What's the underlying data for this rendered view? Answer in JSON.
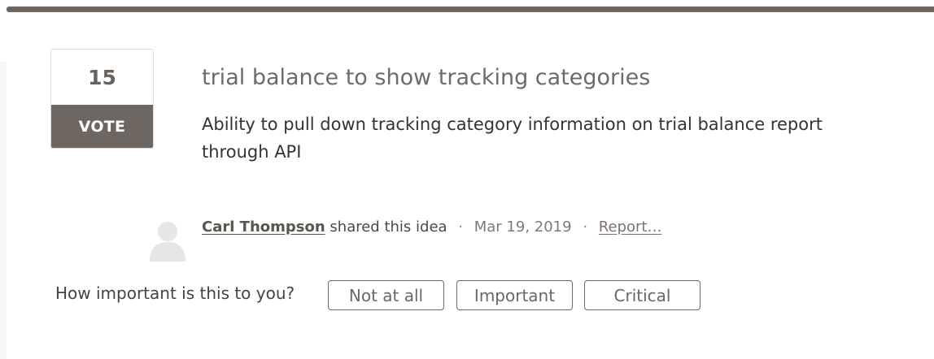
{
  "idea": {
    "vote_count": "15",
    "vote_label": "VOTE",
    "title": "trial balance to show tracking categories",
    "description": "Ability to pull down tracking category information on trial balance report through API"
  },
  "meta": {
    "author": "Carl Thompson",
    "shared_text": "shared this idea",
    "separator": "·",
    "date": "Mar 19, 2019",
    "report_label": "Report…"
  },
  "importance": {
    "question": "How important is this to you?",
    "options": [
      "Not at all",
      "Important",
      "Critical"
    ]
  },
  "icons": {
    "avatar": "user-avatar-icon"
  },
  "colors": {
    "accent": "#6e6660",
    "avatar": "#e6e6e6"
  }
}
